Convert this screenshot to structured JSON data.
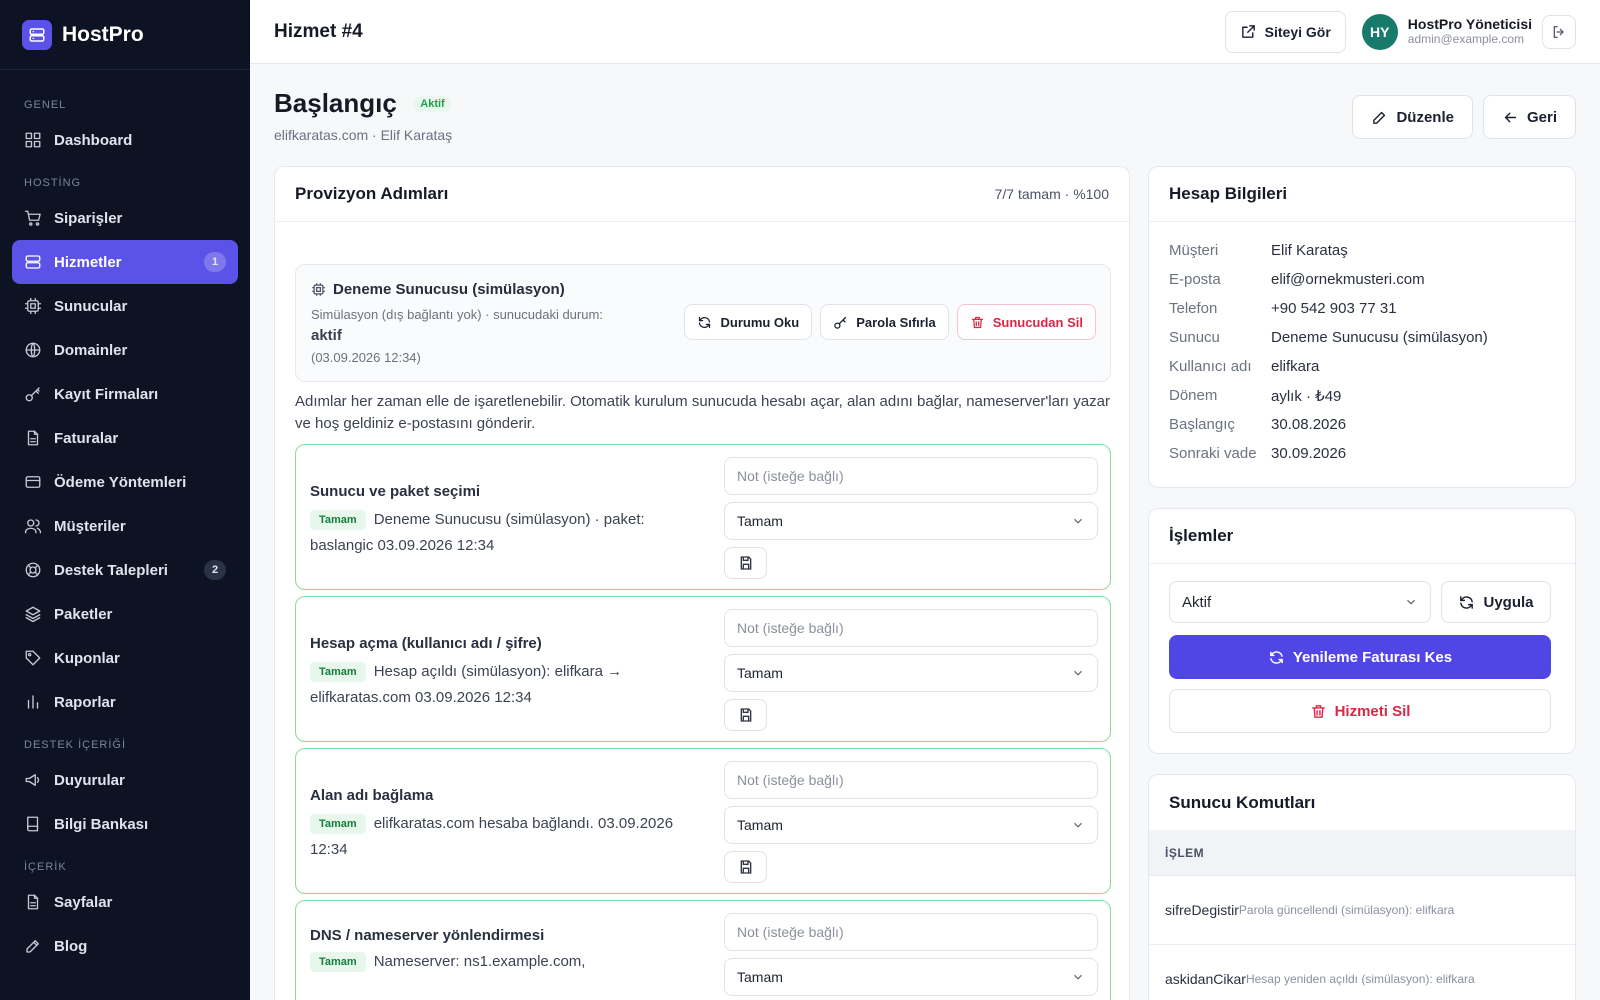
{
  "brand": {
    "name": "HostPro"
  },
  "sidebar": {
    "sections": [
      "GENEL",
      "HOSTİNG",
      "DESTEK İÇERİĞİ",
      "İÇERİK"
    ],
    "items": [
      {
        "label": "Dashboard",
        "icon": "dashboard-icon"
      },
      {
        "label": "Siparişler",
        "icon": "cart-icon"
      },
      {
        "label": "Hizmetler",
        "icon": "server-icon",
        "badge": "1",
        "active": true
      },
      {
        "label": "Sunucular",
        "icon": "cpu-icon"
      },
      {
        "label": "Domainler",
        "icon": "globe-icon"
      },
      {
        "label": "Kayıt Firmaları",
        "icon": "key-icon"
      },
      {
        "label": "Faturalar",
        "icon": "file-icon"
      },
      {
        "label": "Ödeme Yöntemleri",
        "icon": "credit-card-icon"
      },
      {
        "label": "Müşteriler",
        "icon": "users-icon"
      },
      {
        "label": "Destek Talepleri",
        "icon": "lifebuoy-icon",
        "badge": "2"
      },
      {
        "label": "Paketler",
        "icon": "layers-icon"
      },
      {
        "label": "Kuponlar",
        "icon": "tag-icon"
      },
      {
        "label": "Raporlar",
        "icon": "chart-icon"
      },
      {
        "label": "Duyurular",
        "icon": "megaphone-icon"
      },
      {
        "label": "Bilgi Bankası",
        "icon": "book-icon"
      },
      {
        "label": "Sayfalar",
        "icon": "file-icon"
      },
      {
        "label": "Blog",
        "icon": "edit-icon"
      }
    ]
  },
  "topbar": {
    "title": "Hizmet #4",
    "view_site": "Siteyi Gör",
    "user_initials": "HY",
    "user_name": "HostPro Yöneticisi",
    "user_email": "admin@example.com"
  },
  "page": {
    "title": "Başlangıç",
    "status": "Aktif",
    "subtitle": "elifkaratas.com · Elif Karataş",
    "edit_label": "Düzenle",
    "back_label": "Geri"
  },
  "provision": {
    "title": "Provizyon Adımları",
    "progress": "7/7 tamam · %100",
    "server_title": "Deneme Sunucusu (simülasyon)",
    "server_desc": "Simülasyon (dış bağlantı yok) · sunucudaki durum:",
    "server_status": "aktif",
    "server_time": "(03.09.2026 12:34)",
    "btn_read": "Durumu Oku",
    "btn_reset": "Parola Sıfırla",
    "btn_delete": "Sunucudan Sil",
    "note": "Adımlar her zaman elle de işaretlenebilir. Otomatik kurulum sunucuda hesabı açar, alan adını bağlar, nameserver'ları yazar ve hoş geldiniz e-postasını gönderir.",
    "note_placeholder": "Not (isteğe bağlı)",
    "steps": [
      {
        "name": "Sunucu ve paket seçimi",
        "tag": "Tamam",
        "detail": "Deneme Sunucusu (simülasyon) · paket: baslangic 03.09.2026 12:34",
        "select": "Tamam"
      },
      {
        "name": "Hesap açma (kullanıcı adı / şifre)",
        "tag": "Tamam",
        "detail": "Hesap açıldı (simülasyon): elifkara → elifkaratas.com 03.09.2026 12:34",
        "select": "Tamam"
      },
      {
        "name": "Alan adı bağlama",
        "tag": "Tamam",
        "detail": "elifkaratas.com hesaba bağlandı. 03.09.2026 12:34",
        "select": "Tamam"
      },
      {
        "name": "DNS / nameserver yönlendirmesi",
        "tag": "Tamam",
        "detail": "Nameserver: ns1.example.com,",
        "select": "Tamam"
      }
    ]
  },
  "account": {
    "title": "Hesap Bilgileri",
    "rows": [
      {
        "label": "Müşteri",
        "value": "Elif Karataş"
      },
      {
        "label": "E-posta",
        "value": "elif@ornekmusteri.com"
      },
      {
        "label": "Telefon",
        "value": "+90 542 903 77 31"
      },
      {
        "label": "Sunucu",
        "value": "Deneme Sunucusu (simülasyon)"
      },
      {
        "label": "Kullanıcı adı",
        "value": "elifkara"
      },
      {
        "label": "Dönem",
        "value": "aylık · ₺49"
      },
      {
        "label": "Başlangıç",
        "value": "30.08.2026"
      },
      {
        "label": "Sonraki vade",
        "value": "30.09.2026"
      }
    ]
  },
  "operations": {
    "title": "İşlemler",
    "status_value": "Aktif",
    "apply_label": "Uygula",
    "renew_label": "Yenileme Faturası Kes",
    "delete_label": "Hizmeti Sil"
  },
  "commands": {
    "title": "Sunucu Komutları",
    "column": "İŞLEM",
    "rows": [
      {
        "command": "sifreDegistir",
        "message": "Parola güncellendi (simülasyon): elifkara"
      },
      {
        "command": "askidanCikar",
        "message": "Hesap yeniden açıldı (simülasyon): elifkara"
      }
    ]
  },
  "colors": {
    "sidebar_bg": "#0e1324",
    "accent": "#5b52e8",
    "success": "#16a34a",
    "danger": "#dc2646"
  }
}
